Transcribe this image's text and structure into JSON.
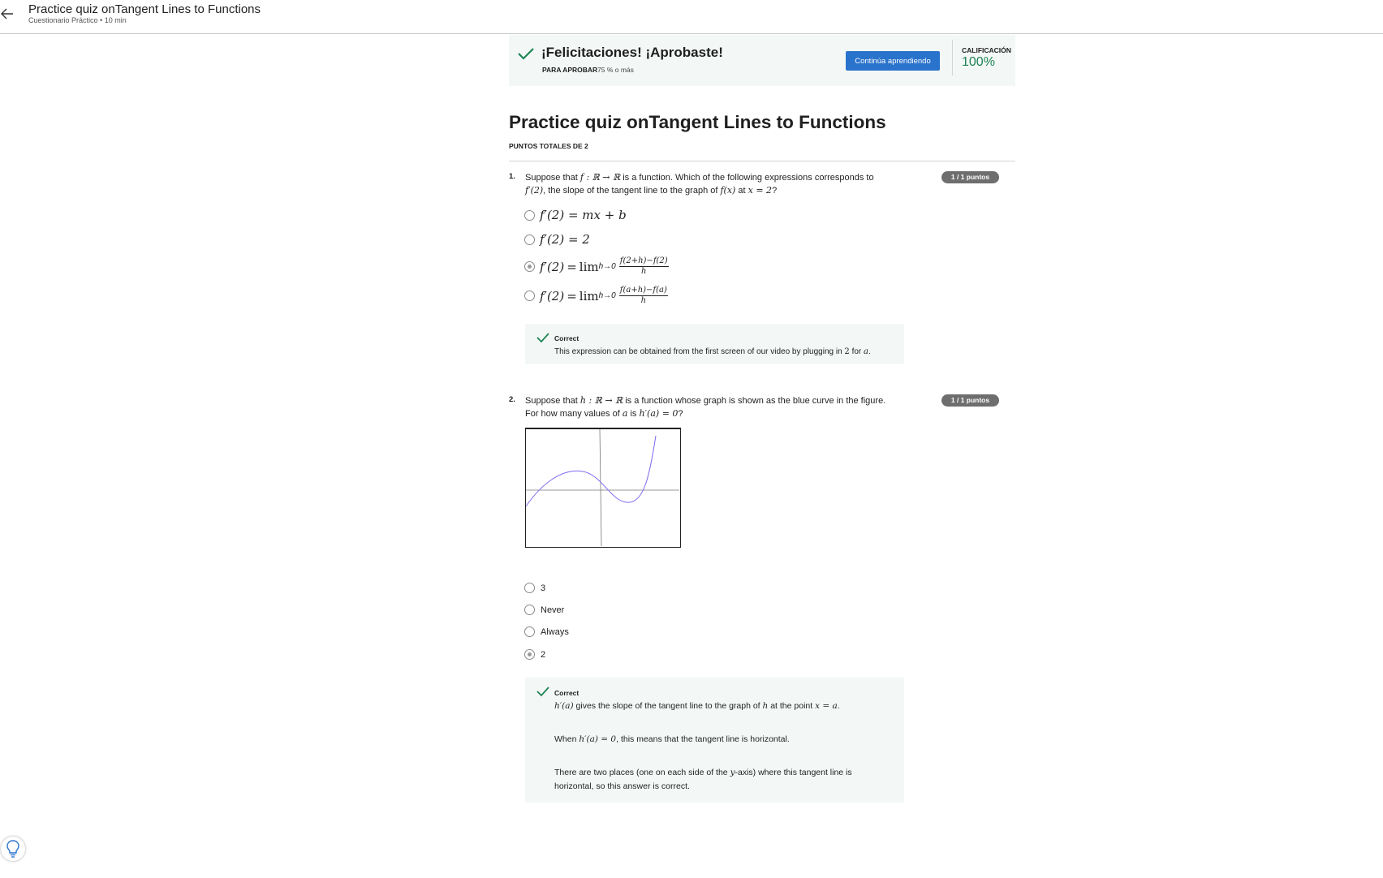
{
  "header": {
    "title": "Practice quiz onTangent Lines to Functions",
    "subtitle": "Cuestionario Práctico • 10 min"
  },
  "banner": {
    "title": "¡Felicitaciones! ¡Aprobaste!",
    "pass_label": "PARA APROBAR",
    "pass_value": "75 % o más",
    "continue_label": "Continúa aprendiendo",
    "grade_label": "CALIFICACIÓN",
    "grade_value": "100%"
  },
  "quiz": {
    "title": "Practice quiz onTangent Lines to Functions",
    "total_points": "PUNTOS TOTALES DE 2"
  },
  "questions": [
    {
      "number": "1.",
      "points": "1 / 1 puntos",
      "text_line1_pre": "Suppose that ",
      "text_line1_math": "f : ℝ → ℝ",
      "text_line1_post": " is a function. Which of the following expressions corresponds to",
      "text_line2_math1": "f′(2)",
      "text_line2_mid": ", the slope of the tangent line to the graph of ",
      "text_line2_math2": "f(x)",
      "text_line2_at": " at ",
      "text_line2_math3": "x = 2",
      "text_line2_end": "?",
      "options": [
        {
          "text": "f′(2) = mx + b",
          "selected": false
        },
        {
          "text": "f′(2) = 2",
          "selected": false
        },
        {
          "lhs": "f′(2)",
          "eq": "=",
          "lim": "lim",
          "lim_sub": "h→0",
          "num": "f(2+h)−f(2)",
          "den": "h",
          "selected": true
        },
        {
          "lhs": "f′(2)",
          "eq": "=",
          "lim": "lim",
          "lim_sub": "h→0",
          "num": "f(a+h)−f(a)",
          "den": "h",
          "selected": false
        }
      ],
      "feedback": {
        "title": "Correct",
        "pre": "This expression can be obtained from the first screen of our video by plugging in ",
        "m1": "2",
        "mid": " for ",
        "m2": "a",
        "end": "."
      }
    },
    {
      "number": "2.",
      "points": "1 / 1 puntos",
      "text_line1_pre": "Suppose that ",
      "text_line1_math": "h : ℝ → ℝ",
      "text_line1_post": " is a function whose graph is shown as the blue curve in the figure.",
      "text_line2_pre": "For how many values of ",
      "text_line2_math1": "a",
      "text_line2_mid": " is ",
      "text_line2_math2": "h′(a) = 0",
      "text_line2_end": "?",
      "options": [
        {
          "text": "3",
          "selected": false
        },
        {
          "text": "Never",
          "selected": false
        },
        {
          "text": "Always",
          "selected": false
        },
        {
          "text": "2",
          "selected": true
        }
      ],
      "feedback": {
        "title": "Correct",
        "p1_m1": "h′(a)",
        "p1_mid": " gives the slope of the tangent line to the graph of ",
        "p1_m2": "h",
        "p1_mid2": " at the point ",
        "p1_m3": "x = a",
        "p1_end": ".",
        "p2_pre": "When ",
        "p2_m": "h′(a) = 0",
        "p2_end": ", this means that the tangent line is horizontal.",
        "p3_pre": "There are two places (one on each side of the ",
        "p3_m": "y",
        "p3_mid": "-axis) where this tangent line is",
        "p3_line2": "horizontal, so this answer is correct."
      }
    }
  ],
  "colors": {
    "accent_blue": "#2a73cc",
    "success_green": "#1f8354",
    "feedback_bg": "#f3f8f6",
    "curve_blue": "#7b6cf0"
  }
}
